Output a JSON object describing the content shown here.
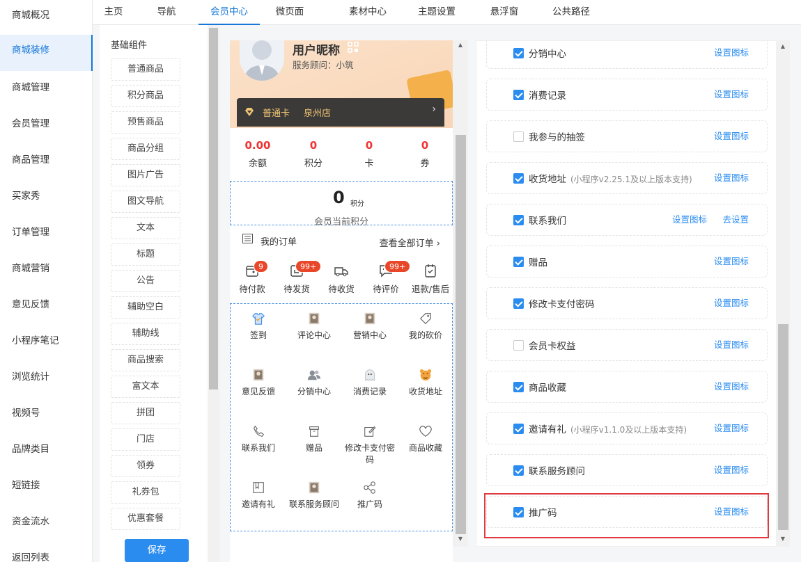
{
  "sidebar": {
    "items": [
      {
        "label": "商城概况",
        "active": false,
        "expand": false
      },
      {
        "label": "商城装修",
        "active": true,
        "expand": false
      },
      {
        "label": "商城管理",
        "active": false,
        "expand": true
      },
      {
        "label": "会员管理",
        "active": false,
        "expand": false
      },
      {
        "label": "商品管理",
        "active": false,
        "expand": false
      },
      {
        "label": "买家秀",
        "active": false,
        "expand": false
      },
      {
        "label": "订单管理",
        "active": false,
        "expand": false
      },
      {
        "label": "商城营销",
        "active": false,
        "expand": false
      },
      {
        "label": "意见反馈",
        "active": false,
        "expand": false
      },
      {
        "label": "小程序笔记",
        "active": false,
        "expand": false
      },
      {
        "label": "浏览统计",
        "active": false,
        "expand": false
      },
      {
        "label": "视频号",
        "active": false,
        "expand": true
      },
      {
        "label": "品牌类目",
        "active": false,
        "expand": false
      },
      {
        "label": "短链接",
        "active": false,
        "expand": false
      },
      {
        "label": "资金流水",
        "active": false,
        "expand": true
      },
      {
        "label": "返回列表",
        "active": false,
        "expand": false
      }
    ]
  },
  "tabs": [
    {
      "label": "主页",
      "active": false
    },
    {
      "label": "导航",
      "active": false
    },
    {
      "label": "会员中心",
      "active": true
    },
    {
      "label": "微页面",
      "active": false
    },
    {
      "label": "素材中心",
      "active": false
    },
    {
      "label": "主题设置",
      "active": false
    },
    {
      "label": "悬浮窗",
      "active": false
    },
    {
      "label": "公共路径",
      "active": false
    }
  ],
  "components": {
    "title": "基础组件",
    "items": [
      "普通商品",
      "积分商品",
      "预售商品",
      "商品分组",
      "图片广告",
      "图文导航",
      "文本",
      "标题",
      "公告",
      "辅助空白",
      "辅助线",
      "商品搜索",
      "富文本",
      "拼团",
      "门店",
      "领券",
      "礼券包",
      "优惠套餐"
    ],
    "save_label": "保存"
  },
  "preview": {
    "nickname": "用户昵称",
    "advisor": "服务顾问：小筑",
    "card_name": "普通卡",
    "card_store": "泉州店",
    "stats": [
      {
        "value": "0.00",
        "label": "余额"
      },
      {
        "value": "0",
        "label": "积分"
      },
      {
        "value": "0",
        "label": "卡"
      },
      {
        "value": "0",
        "label": "券"
      }
    ],
    "points": {
      "value": "0",
      "unit": "积分",
      "label": "会员当前积分"
    },
    "orders": {
      "title": "我的订单",
      "view_all": "查看全部订单",
      "items": [
        {
          "label": "待付款",
          "badge": "9"
        },
        {
          "label": "待发货",
          "badge": "99+"
        },
        {
          "label": "待收货",
          "badge": ""
        },
        {
          "label": "待评价",
          "badge": "99+"
        },
        {
          "label": "退款/售后",
          "badge": ""
        }
      ]
    },
    "grid": [
      {
        "label": "签到",
        "icon": "shirt-icon"
      },
      {
        "label": "评论中心",
        "icon": "photo-icon"
      },
      {
        "label": "营销中心",
        "icon": "photo-icon"
      },
      {
        "label": "我的砍价",
        "icon": "tag-icon"
      },
      {
        "label": "意见反馈",
        "icon": "photo-icon"
      },
      {
        "label": "分销中心",
        "icon": "users-icon"
      },
      {
        "label": "消费记录",
        "icon": "ghost-icon"
      },
      {
        "label": "收货地址",
        "icon": "tiger-icon"
      },
      {
        "label": "联系我们",
        "icon": "phone-icon"
      },
      {
        "label": "赠品",
        "icon": "box-icon"
      },
      {
        "label": "修改卡支付密码",
        "icon": "edit-icon"
      },
      {
        "label": "商品收藏",
        "icon": "heart-icon"
      },
      {
        "label": "邀请有礼",
        "icon": "book-icon"
      },
      {
        "label": "联系服务顾问",
        "icon": "photo-icon"
      },
      {
        "label": "推广码",
        "icon": "share-icon"
      }
    ]
  },
  "settings": {
    "rows": [
      {
        "label": "分销中心",
        "note": "",
        "checked": true,
        "links": [
          "设置图标"
        ]
      },
      {
        "label": "消费记录",
        "note": "",
        "checked": true,
        "links": [
          "设置图标"
        ]
      },
      {
        "label": "我参与的抽签",
        "note": "",
        "checked": false,
        "links": [
          "设置图标"
        ]
      },
      {
        "label": "收货地址",
        "note": "(小程序v2.25.1及以上版本支持)",
        "checked": true,
        "links": [
          "设置图标"
        ]
      },
      {
        "label": "联系我们",
        "note": "",
        "checked": true,
        "links": [
          "设置图标",
          "去设置"
        ]
      },
      {
        "label": "赠品",
        "note": "",
        "checked": true,
        "links": [
          "设置图标"
        ]
      },
      {
        "label": "修改卡支付密码",
        "note": "",
        "checked": true,
        "links": [
          "设置图标"
        ]
      },
      {
        "label": "会员卡权益",
        "note": "",
        "checked": false,
        "links": [
          "设置图标"
        ]
      },
      {
        "label": "商品收藏",
        "note": "",
        "checked": true,
        "links": [
          "设置图标"
        ]
      },
      {
        "label": "邀请有礼",
        "note": "(小程序v1.1.0及以上版本支持)",
        "checked": true,
        "links": [
          "设置图标"
        ]
      },
      {
        "label": "联系服务顾问",
        "note": "",
        "checked": true,
        "links": [
          "设置图标"
        ]
      },
      {
        "label": "推广码",
        "note": "",
        "checked": true,
        "links": [
          "设置图标"
        ]
      }
    ]
  },
  "colors": {
    "accent": "#2b8cf0",
    "badge": "#e8472a",
    "highlight": "#e0393e"
  }
}
